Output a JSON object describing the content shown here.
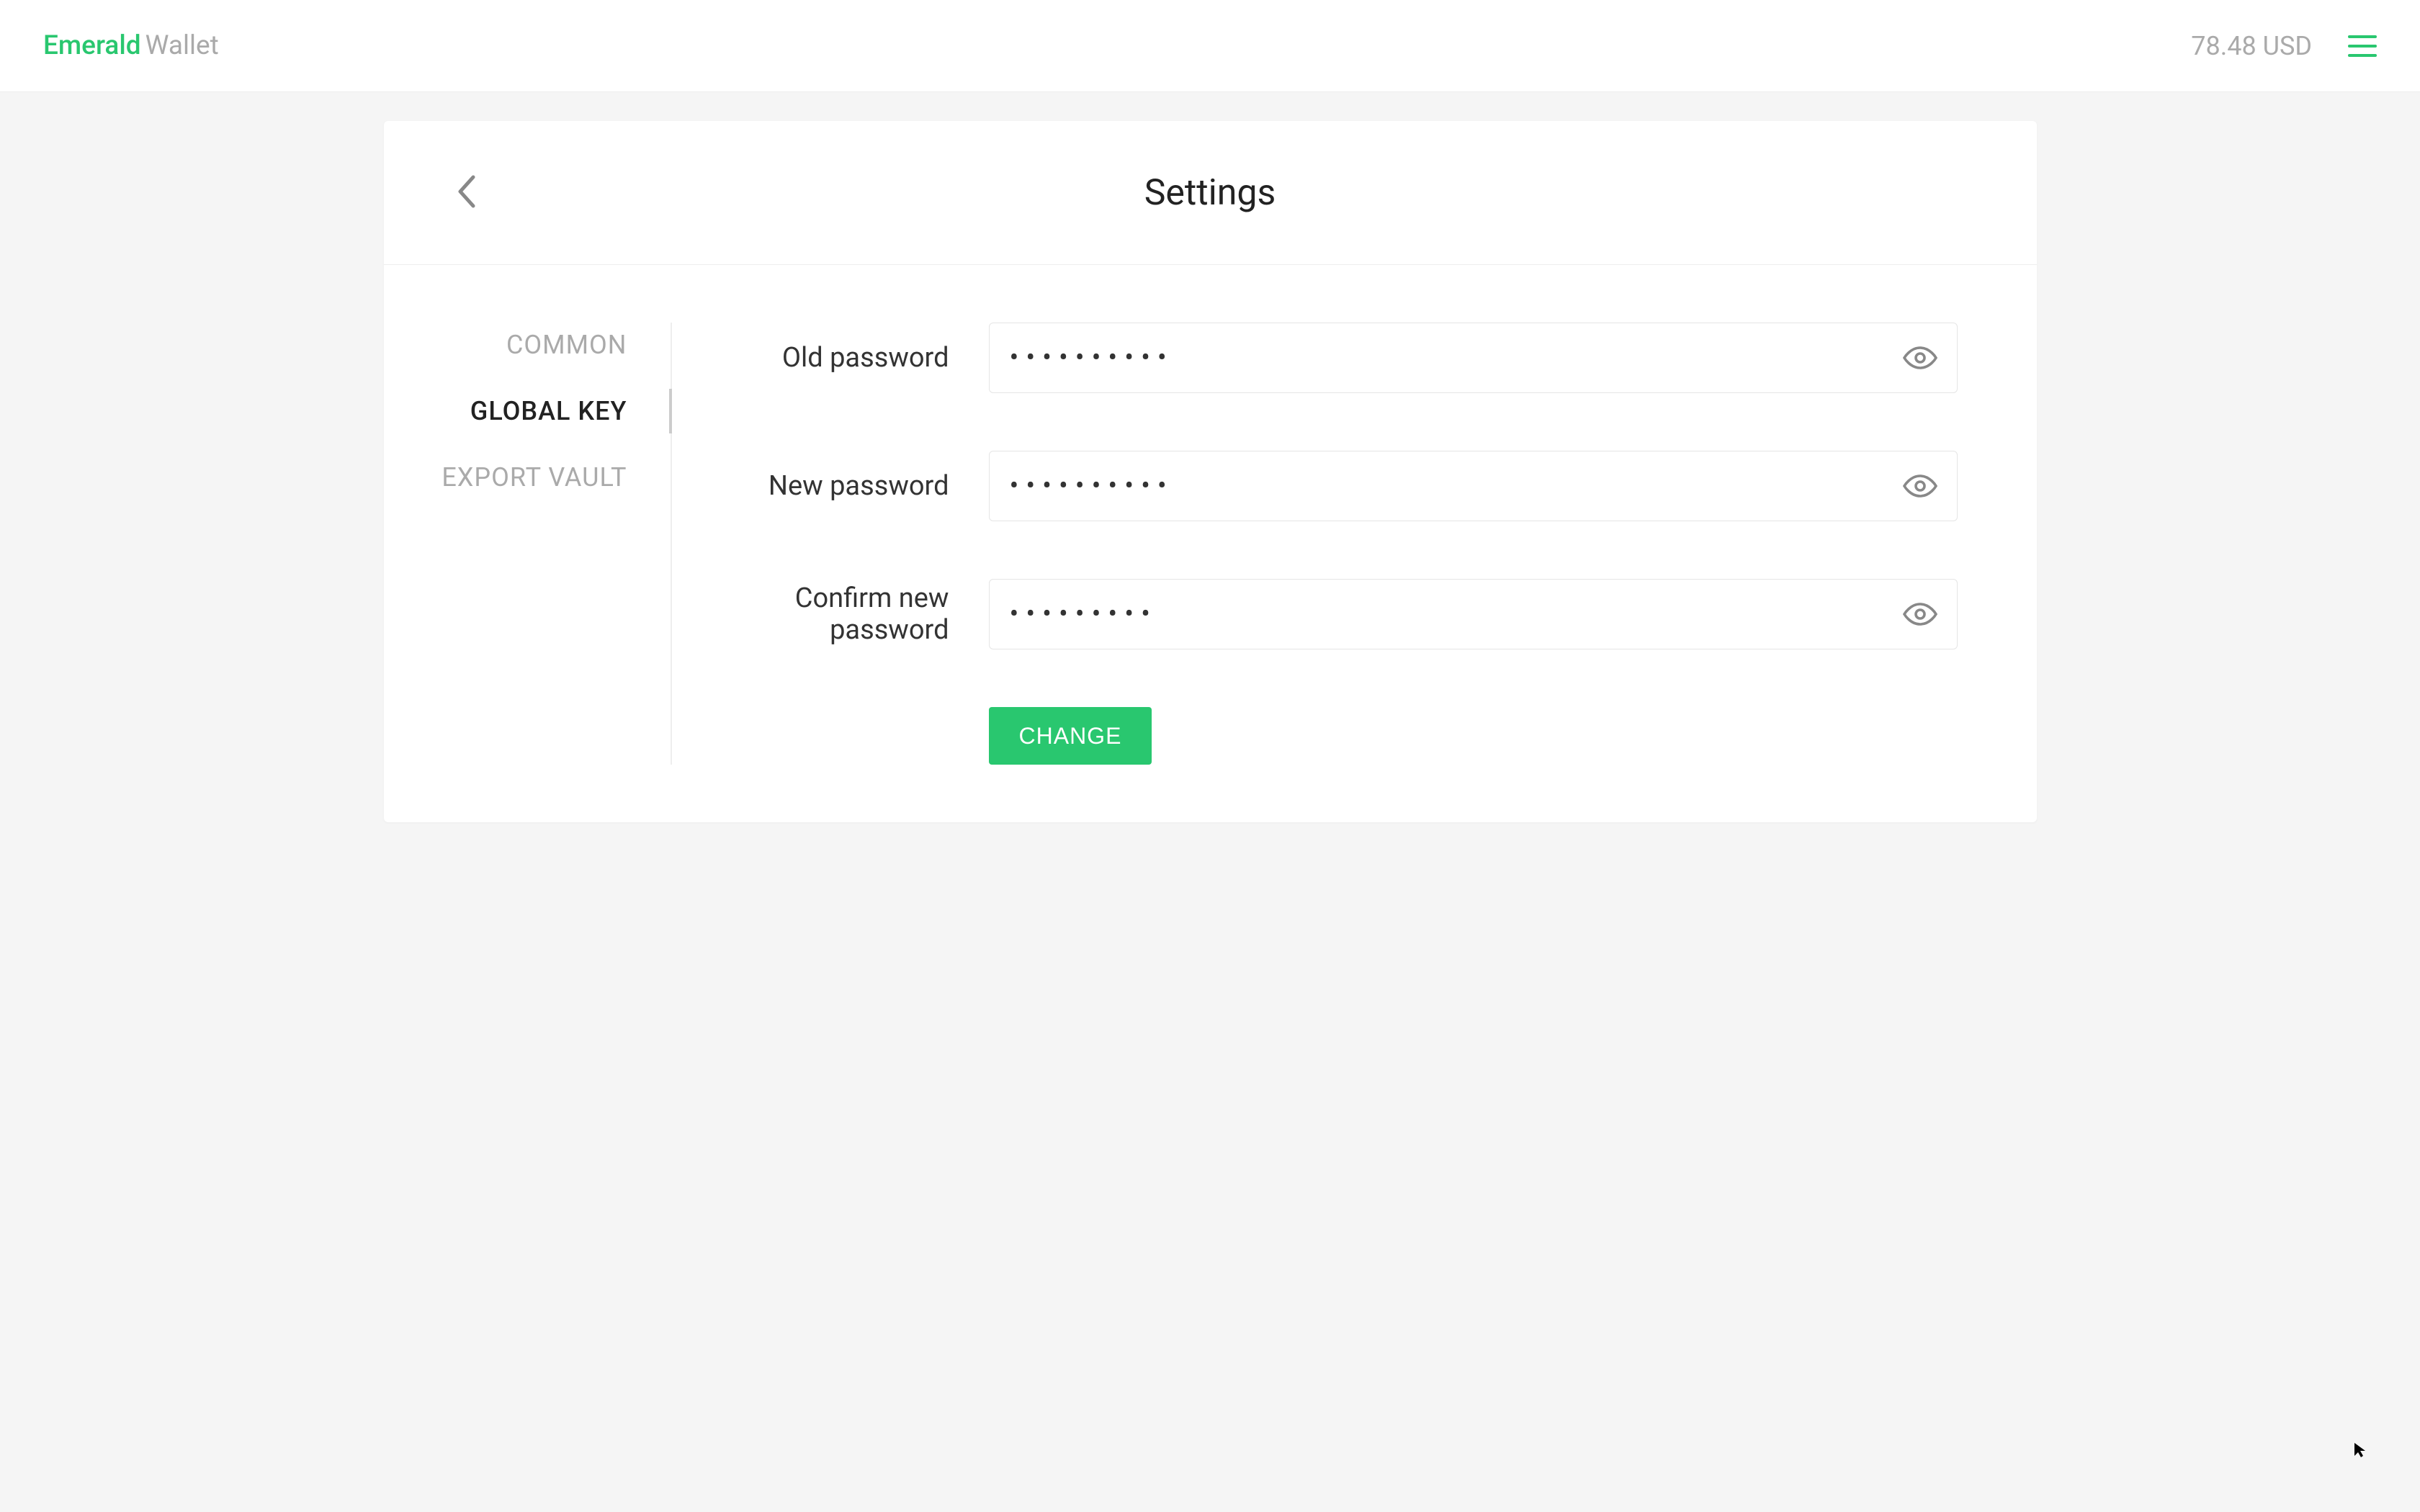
{
  "header": {
    "logo_primary": "Emerald",
    "logo_secondary": "Wallet",
    "balance": "78.48 USD"
  },
  "card": {
    "title": "Settings"
  },
  "tabs": [
    {
      "label": "COMMON",
      "active": false
    },
    {
      "label": "GLOBAL KEY",
      "active": true
    },
    {
      "label": "EXPORT VAULT",
      "active": false
    }
  ],
  "form": {
    "old_password": {
      "label": "Old password",
      "value": "••••••••••"
    },
    "new_password": {
      "label": "New password",
      "value": "••••••••••"
    },
    "confirm_password": {
      "label": "Confirm new password",
      "value": "•••••••••"
    },
    "change_button": "CHANGE"
  }
}
